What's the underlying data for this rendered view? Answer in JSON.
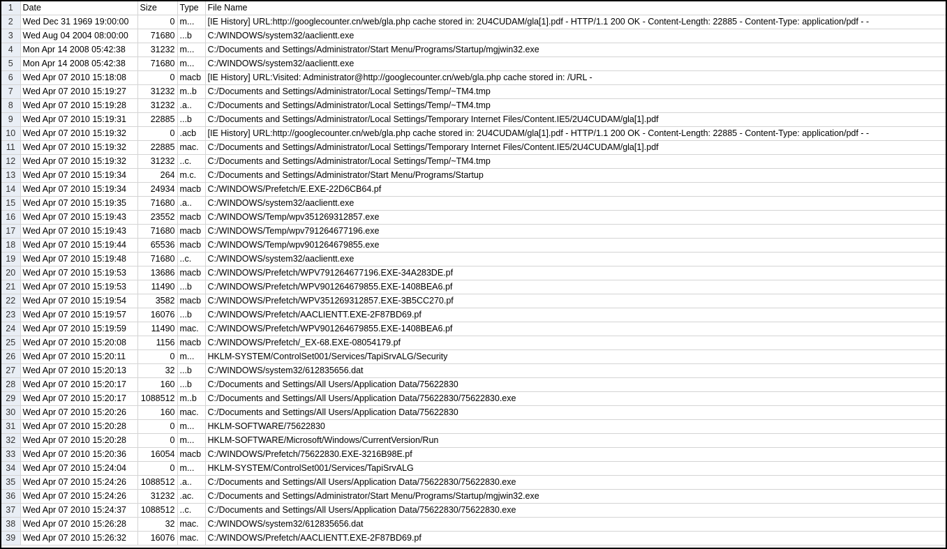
{
  "header": {
    "row_number": "1",
    "date": "Date",
    "size": "Size",
    "type": "Type",
    "file_name": "File Name"
  },
  "rows": [
    {
      "n": "2",
      "date": "Wed Dec 31 1969 19:00:00",
      "size": "0",
      "type": "m...",
      "file": "[IE History] URL:http://googlecounter.cn/web/gla.php cache stored in: 2U4CUDAM/gla[1].pdf - HTTP/1.1 200 OK - Content-Length: 22885 - Content-Type: application/pdf -  -"
    },
    {
      "n": "3",
      "date": "Wed Aug 04 2004 08:00:00",
      "size": "71680",
      "type": "...b",
      "file": "C:/WINDOWS/system32/aaclientt.exe"
    },
    {
      "n": "4",
      "date": "Mon Apr 14 2008 05:42:38",
      "size": "31232",
      "type": "m...",
      "file": "C:/Documents and Settings/Administrator/Start Menu/Programs/Startup/mgjwin32.exe"
    },
    {
      "n": "5",
      "date": "Mon Apr 14 2008 05:42:38",
      "size": "71680",
      "type": "m...",
      "file": "C:/WINDOWS/system32/aaclientt.exe"
    },
    {
      "n": "6",
      "date": "Wed Apr 07 2010 15:18:08",
      "size": "0",
      "type": "macb",
      "file": "[IE History] URL:Visited: Administrator@http://googlecounter.cn/web/gla.php cache stored in: /URL  -"
    },
    {
      "n": "7",
      "date": "Wed Apr 07 2010 15:19:27",
      "size": "31232",
      "type": "m..b",
      "file": "C:/Documents and Settings/Administrator/Local Settings/Temp/~TM4.tmp"
    },
    {
      "n": "8",
      "date": "Wed Apr 07 2010 15:19:28",
      "size": "31232",
      "type": ".a..",
      "file": "C:/Documents and Settings/Administrator/Local Settings/Temp/~TM4.tmp"
    },
    {
      "n": "9",
      "date": "Wed Apr 07 2010 15:19:31",
      "size": "22885",
      "type": "...b",
      "file": "C:/Documents and Settings/Administrator/Local Settings/Temporary Internet Files/Content.IE5/2U4CUDAM/gla[1].pdf"
    },
    {
      "n": "10",
      "date": "Wed Apr 07 2010 15:19:32",
      "size": "0",
      "type": ".acb",
      "file": "[IE History] URL:http://googlecounter.cn/web/gla.php cache stored in: 2U4CUDAM/gla[1].pdf - HTTP/1.1 200 OK - Content-Length: 22885 - Content-Type: application/pdf -  -"
    },
    {
      "n": "11",
      "date": "Wed Apr 07 2010 15:19:32",
      "size": "22885",
      "type": "mac.",
      "file": "C:/Documents and Settings/Administrator/Local Settings/Temporary Internet Files/Content.IE5/2U4CUDAM/gla[1].pdf"
    },
    {
      "n": "12",
      "date": "Wed Apr 07 2010 15:19:32",
      "size": "31232",
      "type": "..c.",
      "file": "C:/Documents and Settings/Administrator/Local Settings/Temp/~TM4.tmp"
    },
    {
      "n": "13",
      "date": "Wed Apr 07 2010 15:19:34",
      "size": "264",
      "type": "m.c.",
      "file": "C:/Documents and Settings/Administrator/Start Menu/Programs/Startup"
    },
    {
      "n": "14",
      "date": "Wed Apr 07 2010 15:19:34",
      "size": "24934",
      "type": "macb",
      "file": "C:/WINDOWS/Prefetch/E.EXE-22D6CB64.pf"
    },
    {
      "n": "15",
      "date": "Wed Apr 07 2010 15:19:35",
      "size": "71680",
      "type": ".a..",
      "file": "C:/WINDOWS/system32/aaclientt.exe"
    },
    {
      "n": "16",
      "date": "Wed Apr 07 2010 15:19:43",
      "size": "23552",
      "type": "macb",
      "file": "C:/WINDOWS/Temp/wpv351269312857.exe"
    },
    {
      "n": "17",
      "date": "Wed Apr 07 2010 15:19:43",
      "size": "71680",
      "type": "macb",
      "file": "C:/WINDOWS/Temp/wpv791264677196.exe"
    },
    {
      "n": "18",
      "date": "Wed Apr 07 2010 15:19:44",
      "size": "65536",
      "type": "macb",
      "file": "C:/WINDOWS/Temp/wpv901264679855.exe"
    },
    {
      "n": "19",
      "date": "Wed Apr 07 2010 15:19:48",
      "size": "71680",
      "type": "..c.",
      "file": "C:/WINDOWS/system32/aaclientt.exe"
    },
    {
      "n": "20",
      "date": "Wed Apr 07 2010 15:19:53",
      "size": "13686",
      "type": "macb",
      "file": "C:/WINDOWS/Prefetch/WPV791264677196.EXE-34A283DE.pf"
    },
    {
      "n": "21",
      "date": "Wed Apr 07 2010 15:19:53",
      "size": "11490",
      "type": "...b",
      "file": "C:/WINDOWS/Prefetch/WPV901264679855.EXE-1408BEA6.pf"
    },
    {
      "n": "22",
      "date": "Wed Apr 07 2010 15:19:54",
      "size": "3582",
      "type": "macb",
      "file": "C:/WINDOWS/Prefetch/WPV351269312857.EXE-3B5CC270.pf"
    },
    {
      "n": "23",
      "date": "Wed Apr 07 2010 15:19:57",
      "size": "16076",
      "type": "...b",
      "file": "C:/WINDOWS/Prefetch/AACLIENTT.EXE-2F87BD69.pf"
    },
    {
      "n": "24",
      "date": "Wed Apr 07 2010 15:19:59",
      "size": "11490",
      "type": "mac.",
      "file": "C:/WINDOWS/Prefetch/WPV901264679855.EXE-1408BEA6.pf"
    },
    {
      "n": "25",
      "date": "Wed Apr 07 2010 15:20:08",
      "size": "1156",
      "type": "macb",
      "file": "C:/WINDOWS/Prefetch/_EX-68.EXE-08054179.pf"
    },
    {
      "n": "26",
      "date": "Wed Apr 07 2010 15:20:11",
      "size": "0",
      "type": "m...",
      "file": "HKLM-SYSTEM/ControlSet001/Services/TapiSrvALG/Security"
    },
    {
      "n": "27",
      "date": "Wed Apr 07 2010 15:20:13",
      "size": "32",
      "type": "...b",
      "file": "C:/WINDOWS/system32/612835656.dat"
    },
    {
      "n": "28",
      "date": "Wed Apr 07 2010 15:20:17",
      "size": "160",
      "type": "...b",
      "file": "C:/Documents and Settings/All Users/Application Data/75622830"
    },
    {
      "n": "29",
      "date": "Wed Apr 07 2010 15:20:17",
      "size": "1088512",
      "type": "m..b",
      "file": "C:/Documents and Settings/All Users/Application Data/75622830/75622830.exe"
    },
    {
      "n": "30",
      "date": "Wed Apr 07 2010 15:20:26",
      "size": "160",
      "type": "mac.",
      "file": "C:/Documents and Settings/All Users/Application Data/75622830"
    },
    {
      "n": "31",
      "date": "Wed Apr 07 2010 15:20:28",
      "size": "0",
      "type": "m...",
      "file": "HKLM-SOFTWARE/75622830"
    },
    {
      "n": "32",
      "date": "Wed Apr 07 2010 15:20:28",
      "size": "0",
      "type": "m...",
      "file": "HKLM-SOFTWARE/Microsoft/Windows/CurrentVersion/Run"
    },
    {
      "n": "33",
      "date": "Wed Apr 07 2010 15:20:36",
      "size": "16054",
      "type": "macb",
      "file": "C:/WINDOWS/Prefetch/75622830.EXE-3216B98E.pf"
    },
    {
      "n": "34",
      "date": "Wed Apr 07 2010 15:24:04",
      "size": "0",
      "type": "m...",
      "file": "HKLM-SYSTEM/ControlSet001/Services/TapiSrvALG"
    },
    {
      "n": "35",
      "date": "Wed Apr 07 2010 15:24:26",
      "size": "1088512",
      "type": ".a..",
      "file": "C:/Documents and Settings/All Users/Application Data/75622830/75622830.exe"
    },
    {
      "n": "36",
      "date": "Wed Apr 07 2010 15:24:26",
      "size": "31232",
      "type": ".ac.",
      "file": "C:/Documents and Settings/Administrator/Start Menu/Programs/Startup/mgjwin32.exe"
    },
    {
      "n": "37",
      "date": "Wed Apr 07 2010 15:24:37",
      "size": "1088512",
      "type": "..c.",
      "file": "C:/Documents and Settings/All Users/Application Data/75622830/75622830.exe"
    },
    {
      "n": "38",
      "date": "Wed Apr 07 2010 15:26:28",
      "size": "32",
      "type": "mac.",
      "file": "C:/WINDOWS/system32/612835656.dat"
    },
    {
      "n": "39",
      "date": "Wed Apr 07 2010 15:26:32",
      "size": "16076",
      "type": "mac.",
      "file": "C:/WINDOWS/Prefetch/AACLIENTT.EXE-2F87BD69.pf"
    }
  ],
  "colors": {
    "row_header_bg": "#e9eef5",
    "gridline": "#d4d4d4",
    "frame_border": "#000000"
  }
}
